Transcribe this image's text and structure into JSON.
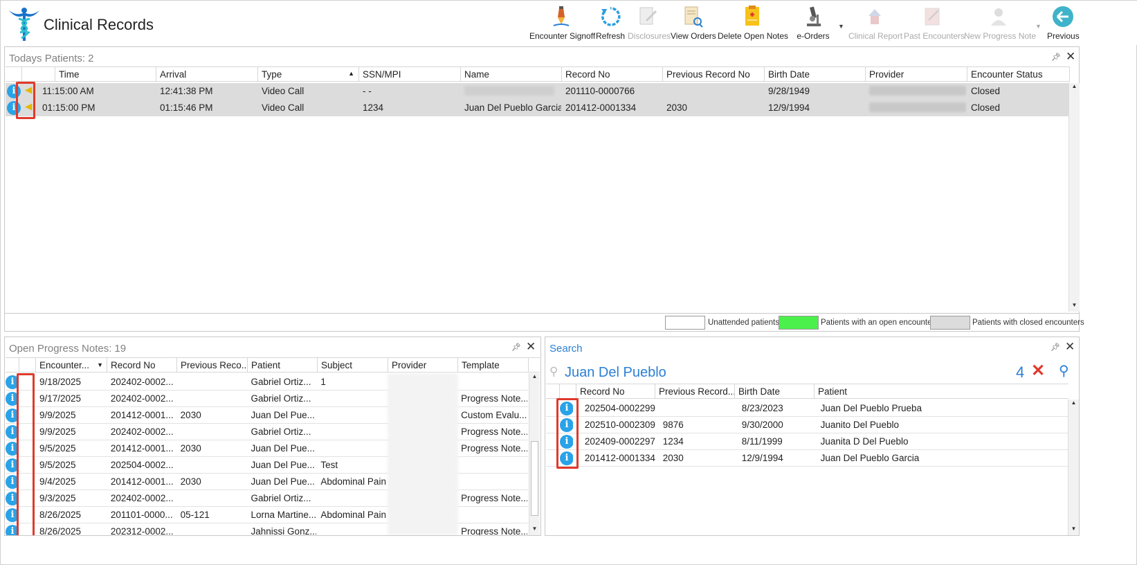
{
  "app": {
    "title": "Clinical Records"
  },
  "toolbar": {
    "encounter_signoff": "Encounter Signoff",
    "refresh": "Refresh",
    "disclosures": "Disclosures",
    "view_orders": "View Orders",
    "delete_open_notes": "Delete Open Notes",
    "e_orders": "e-Orders",
    "clinical_report": "Clinical Report",
    "past_encounters": "Past Encounters",
    "new_progress_note": "New Progress Note",
    "previous": "Previous"
  },
  "todays_patients": {
    "title": "Todays Patients:",
    "count": "2",
    "columns": [
      "Time",
      "Arrival",
      "Type",
      "SSN/MPI",
      "Name",
      "Record No",
      "Previous Record No",
      "Birth Date",
      "Provider",
      "Encounter Status"
    ],
    "rows": [
      {
        "time": "11:15:00 AM",
        "arrival": "12:41:38 PM",
        "type": "Video Call",
        "ssn": "-  -",
        "name": "",
        "record_no": "201110-0000766",
        "prev_record": "",
        "birth_date": "9/28/1949",
        "provider": "",
        "status": "Closed"
      },
      {
        "time": "01:15:00 PM",
        "arrival": "01:15:46 PM",
        "type": "Video Call",
        "ssn": "1234",
        "name": "Juan Del Pueblo Garcia",
        "record_no": "201412-0001334",
        "prev_record": "2030",
        "birth_date": "12/9/1994",
        "provider": "",
        "status": "Closed"
      }
    ],
    "legend": {
      "unattended": "Unattended patients",
      "open": "Patients with an open encounter",
      "closed": "Patients with closed encounters"
    }
  },
  "open_notes": {
    "title": "Open Progress Notes:",
    "count": "19",
    "columns": [
      "Encounter...",
      "Record No",
      "Previous Reco...",
      "Patient",
      "Subject",
      "Provider",
      "Template"
    ],
    "rows": [
      {
        "date": "9/18/2025",
        "record": "202402-0002...",
        "prev": "",
        "patient": "Gabriel Ortiz...",
        "subject": "1",
        "template": ""
      },
      {
        "date": "9/17/2025",
        "record": "202402-0002...",
        "prev": "",
        "patient": "Gabriel Ortiz...",
        "subject": "",
        "template": "Progress Note..."
      },
      {
        "date": "9/9/2025",
        "record": "201412-0001...",
        "prev": "2030",
        "patient": "Juan Del Pue...",
        "subject": "",
        "template": "Custom Evalu..."
      },
      {
        "date": "9/9/2025",
        "record": "202402-0002...",
        "prev": "",
        "patient": "Gabriel Ortiz...",
        "subject": "",
        "template": "Progress Note..."
      },
      {
        "date": "9/5/2025",
        "record": "201412-0001...",
        "prev": "2030",
        "patient": "Juan Del Pue...",
        "subject": "",
        "template": "Progress Note..."
      },
      {
        "date": "9/5/2025",
        "record": "202504-0002...",
        "prev": "",
        "patient": "Juan Del Pue...",
        "subject": "Test",
        "template": ""
      },
      {
        "date": "9/4/2025",
        "record": "201412-0001...",
        "prev": "2030",
        "patient": "Juan Del Pue...",
        "subject": "Abdominal Pain",
        "template": ""
      },
      {
        "date": "9/3/2025",
        "record": "202402-0002...",
        "prev": "",
        "patient": "Gabriel Ortiz...",
        "subject": "",
        "template": "Progress Note..."
      },
      {
        "date": "8/26/2025",
        "record": "201101-0000...",
        "prev": "05-121",
        "patient": "Lorna Martine...",
        "subject": "Abdominal Pain",
        "template": ""
      },
      {
        "date": "8/26/2025",
        "record": "202312-0002...",
        "prev": "",
        "patient": "Jahnissi Gonz...",
        "subject": "",
        "template": "Progress Note..."
      }
    ]
  },
  "search": {
    "title": "Search",
    "term": "Juan Del Pueblo",
    "count": "4",
    "columns": [
      "Record No",
      "Previous Record...",
      "Birth Date",
      "Patient"
    ],
    "rows": [
      {
        "record": "202504-0002299",
        "prev": "",
        "birth": "8/23/2023",
        "patient": "Juan Del Pueblo Prueba"
      },
      {
        "record": "202510-0002309",
        "prev": "9876",
        "birth": "9/30/2000",
        "patient": "Juanito Del Pueblo"
      },
      {
        "record": "202409-0002297",
        "prev": "1234",
        "birth": "8/11/1999",
        "patient": "Juanita D Del Pueblo"
      },
      {
        "record": "201412-0001334",
        "prev": "2030",
        "birth": "12/9/1994",
        "patient": "Juan Del Pueblo Garcia"
      }
    ]
  },
  "colors": {
    "accent": "#29a3e8",
    "highlight_box": "#e0392b",
    "closed_row": "#dcdcdc",
    "open_legend": "#4cf04c"
  }
}
